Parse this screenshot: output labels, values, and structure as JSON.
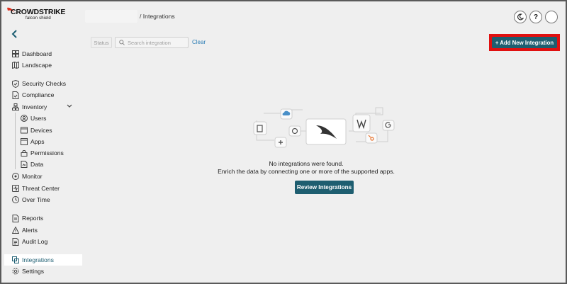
{
  "brand": {
    "name": "CROWDSTRIKE",
    "product": "falcon shield"
  },
  "header": {
    "breadcrumb_sep": "/",
    "breadcrumb_current": "Integrations",
    "buttons": [
      {
        "icon": "moon-icon",
        "label": ""
      },
      {
        "icon": "help-icon",
        "label": "?"
      },
      {
        "icon": "avatar",
        "label": ""
      }
    ]
  },
  "sidebar": {
    "collapse_icon": "chevron-left-icon",
    "items": [
      {
        "label": "Dashboard",
        "icon": "dashboard-icon"
      },
      {
        "label": "Landscape",
        "icon": "map-icon"
      },
      {
        "label": "Security Checks",
        "icon": "shield-check-icon"
      },
      {
        "label": "Compliance",
        "icon": "document-check-icon"
      },
      {
        "label": "Inventory",
        "icon": "inventory-icon"
      },
      {
        "label": "Users",
        "icon": "user-icon"
      },
      {
        "label": "Devices",
        "icon": "device-icon"
      },
      {
        "label": "Apps",
        "icon": "apps-icon"
      },
      {
        "label": "Permissions",
        "icon": "lock-icon"
      },
      {
        "label": "Data",
        "icon": "data-icon"
      },
      {
        "label": "Monitor",
        "icon": "monitor-icon"
      },
      {
        "label": "Threat Center",
        "icon": "threat-icon"
      },
      {
        "label": "Over Time",
        "icon": "clock-icon"
      },
      {
        "label": "Reports",
        "icon": "report-icon"
      },
      {
        "label": "Alerts",
        "icon": "alert-icon"
      },
      {
        "label": "Audit Log",
        "icon": "audit-log-icon"
      },
      {
        "label": "Integrations",
        "icon": "integrations-icon"
      },
      {
        "label": "Settings",
        "icon": "gear-icon"
      }
    ],
    "active": "Integrations"
  },
  "filters": {
    "status_label": "Status",
    "search_placeholder": "Search integration",
    "clear_label": "Clear"
  },
  "actions": {
    "add_label": "+ Add New Integration"
  },
  "empty_state": {
    "title": "No integrations were found.",
    "subtitle": "Enrich the data by connecting one or more of the supported apps.",
    "button_label": "Review Integrations"
  },
  "colors": {
    "accent": "#1e5e70",
    "highlight_border": "#e01010",
    "link": "#2a7cb4",
    "background": "#efefef"
  }
}
